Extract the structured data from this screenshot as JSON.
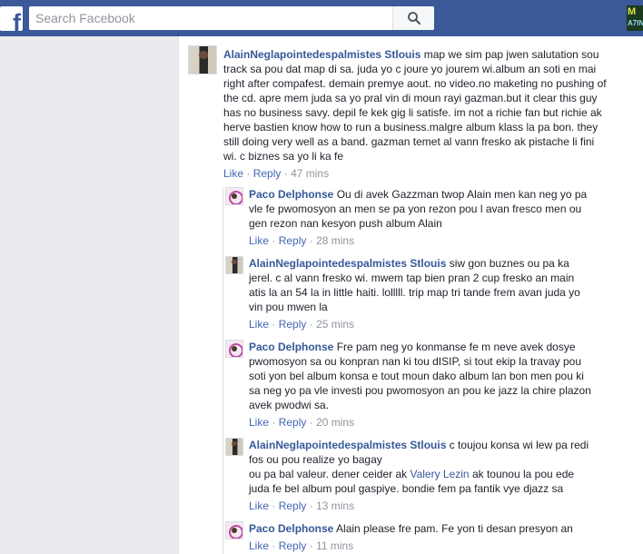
{
  "header": {
    "logo": "f",
    "search": {
      "placeholder": "Search Facebook"
    },
    "icons": {
      "search": "search-icon"
    },
    "corner_thumb": {
      "line1": "M",
      "line2": "A7IN"
    }
  },
  "colors": {
    "bar": "#3b5998",
    "link": "#365899",
    "action": "#4267b2",
    "meta": "#90949c"
  },
  "actions": {
    "like": "Like",
    "reply": "Reply",
    "separator": "·"
  },
  "comments": [
    {
      "author": "AlainNeglapointedespalmistes Stlouis",
      "avatar": "alain",
      "lines": [
        " map we sim pap jwen salutation sou",
        "track sa pou dat map di sa. juda yo c joure yo jourem wi.album an soti en mai",
        "right after compafest. demain premye aout. no video.no maketing no pushing of",
        "the cd. apre mem juda sa yo pral vin di moun rayi gazman.but it clear this guy",
        "has no business savy. depil fe kek gig li satisfe. im not a richie fan but richie ak",
        "herve bastien know how to run a business.malgre album klass la pa bon. they",
        "still doing very well as a band. gazman temet al vann fresko ak pistache li fini",
        "wi. c biznes sa yo li ka fe"
      ],
      "time": "47 mins"
    },
    {
      "author": "Paco Delphonse",
      "avatar": "paco",
      "lines": [
        " Ou di avek Gazzman twop Alain men kan neg yo pa",
        "vle fe pwomosyon an men se pa yon rezon pou l avan fresco men ou",
        "gen rezon nan kesyon push album Alain"
      ],
      "time": "28 mins"
    },
    {
      "author": "AlainNeglapointedespalmistes Stlouis",
      "avatar": "alain",
      "lines": [
        " siw gon buznes ou pa ka",
        "jerel. c al vann fresko wi. mwem tap bien pran 2 cup fresko an main",
        "atis la an 54 la in little haiti. lolllll. trip map tri tande frem avan juda yo",
        "vin pou mwen la"
      ],
      "time": "25 mins"
    },
    {
      "author": "Paco Delphonse",
      "avatar": "paco",
      "lines": [
        " Fre pam neg yo konmanse fe m neve avek dosye",
        "pwomosyon sa ou konpran nan ki tou dISIP, si tout ekip la travay pou",
        "soti yon bel album konsa e tout moun dako album lan bon men pou ki",
        "sa neg yo pa vle investi pou pwomosyon an pou ke jazz la chire plazon",
        "avek pwodwi sa."
      ],
      "time": "20 mins"
    },
    {
      "author": "AlainNeglapointedespalmistes Stlouis",
      "avatar": "alain",
      "lines": [
        " c toujou konsa wi lew pa redi",
        "fos ou pou realize yo bagay",
        "ou pa bal valeur. dener ceider ak ",
        "juda fe bel album poul gaspiye. bondie fem pa fantik vye djazz sa"
      ],
      "tag": "Valery Lezin",
      "tag_after": " ak tounou la pou ede",
      "time": "13 mins"
    },
    {
      "author": "Paco Delphonse",
      "avatar": "paco",
      "lines": [
        " Alain please fre pam. Fe yon ti desan presyon an"
      ],
      "time": "11 mins"
    }
  ]
}
